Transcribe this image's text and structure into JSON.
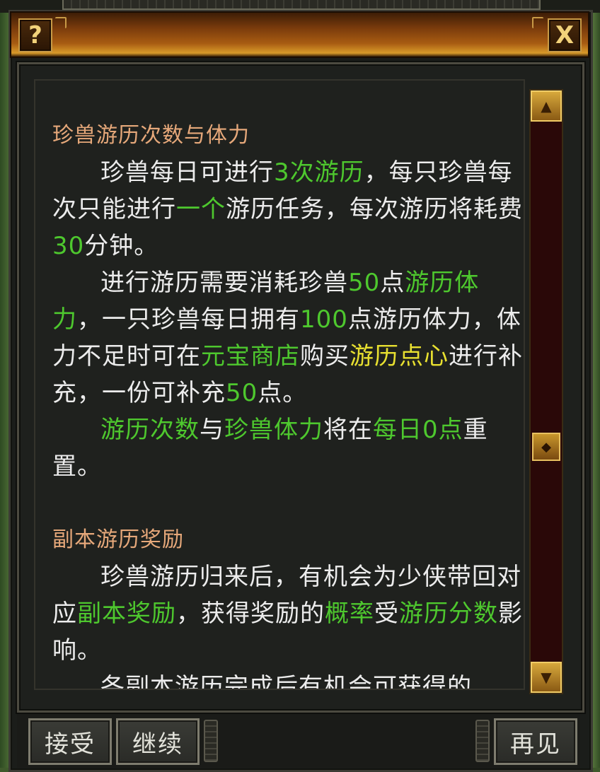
{
  "window": {
    "help_icon_label": "?",
    "close_icon_label": "X"
  },
  "sections": [
    {
      "heading": "珍兽游历次数与体力",
      "paragraphs": [
        [
          {
            "text": "珍兽每日可进行",
            "color": "white"
          },
          {
            "text": "3次",
            "color": "green"
          },
          {
            "text": "游历",
            "color": "green"
          },
          {
            "text": "，每只珍兽每次只能进行",
            "color": "white"
          },
          {
            "text": "一个",
            "color": "green"
          },
          {
            "text": "游历任务，每次游历将耗费",
            "color": "white"
          },
          {
            "text": "30",
            "color": "green"
          },
          {
            "text": "分钟。",
            "color": "white"
          }
        ],
        [
          {
            "text": "进行游历需要消耗珍兽",
            "color": "white"
          },
          {
            "text": "50",
            "color": "green"
          },
          {
            "text": "点",
            "color": "white"
          },
          {
            "text": "游历体力",
            "color": "green"
          },
          {
            "text": "，一只珍兽每日拥有",
            "color": "white"
          },
          {
            "text": "100",
            "color": "green"
          },
          {
            "text": "点游历体力，体力不足时可在",
            "color": "white"
          },
          {
            "text": "元宝商店",
            "color": "green"
          },
          {
            "text": "购买",
            "color": "white"
          },
          {
            "text": "游历点心",
            "color": "yellow"
          },
          {
            "text": "进行补充，一份可补充",
            "color": "white"
          },
          {
            "text": "50",
            "color": "green"
          },
          {
            "text": "点。",
            "color": "white"
          }
        ],
        [
          {
            "text": "游历次数",
            "color": "green"
          },
          {
            "text": "与",
            "color": "white"
          },
          {
            "text": "珍兽体力",
            "color": "green"
          },
          {
            "text": "将在",
            "color": "white"
          },
          {
            "text": "每日0点",
            "color": "green"
          },
          {
            "text": "重置。",
            "color": "white"
          }
        ]
      ]
    },
    {
      "heading": "副本游历奖励",
      "paragraphs": [
        [
          {
            "text": "珍兽游历归来后，有机会为少侠带回对应",
            "color": "white"
          },
          {
            "text": "副本奖励",
            "color": "green"
          },
          {
            "text": "，获得奖励的",
            "color": "white"
          },
          {
            "text": "概率",
            "color": "green"
          },
          {
            "text": "受",
            "color": "white"
          },
          {
            "text": "游历分数",
            "color": "green"
          },
          {
            "text": "影响。",
            "color": "white"
          }
        ],
        [
          {
            "text": "各副本游历完成后有机会可获得的",
            "color": "white"
          }
        ]
      ]
    }
  ],
  "colors": {
    "white": "#ececec",
    "green": "#4ec82e",
    "yellow": "#e8e030",
    "heading": "#e6a87a"
  },
  "scrollbar": {
    "up_icon": "scroll-up-arrow-icon",
    "down_icon": "scroll-down-arrow-icon",
    "thumb_icon": "diamond-icon",
    "scroll_position": 0.55
  },
  "buttons": {
    "accept": "接受",
    "continue": "继续",
    "goodbye": "再见"
  }
}
